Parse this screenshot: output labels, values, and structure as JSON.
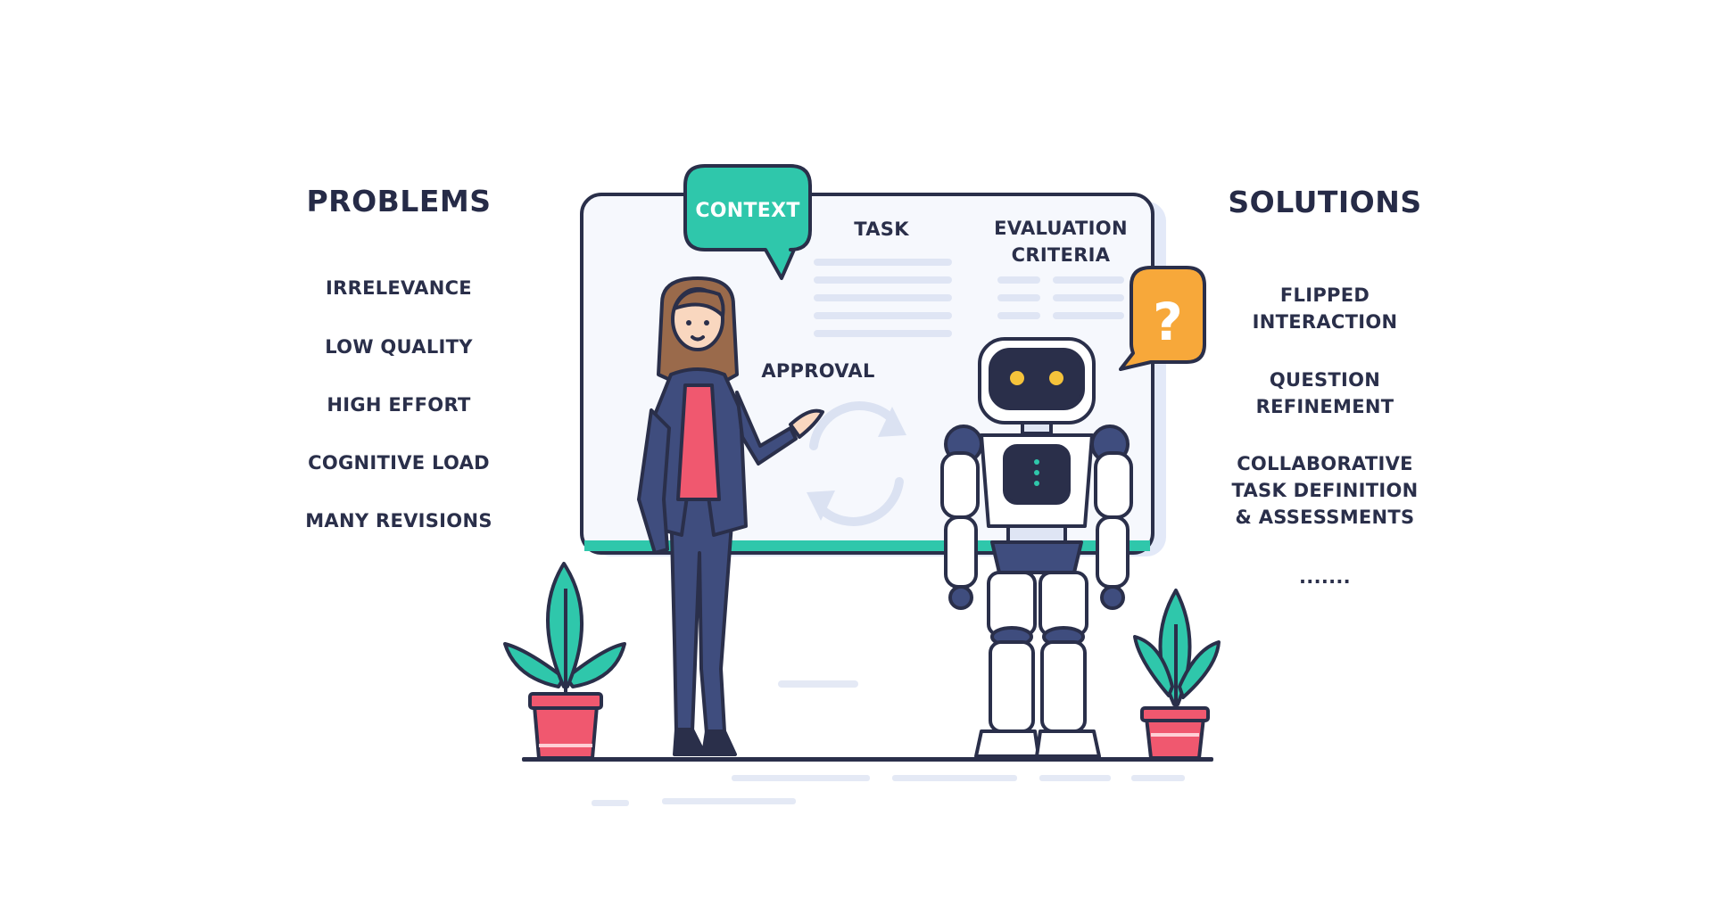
{
  "problems": {
    "heading": "PROBLEMS",
    "items": [
      {
        "label": "IRRELEVANCE"
      },
      {
        "label": "LOW QUALITY"
      },
      {
        "label": "HIGH EFFORT"
      },
      {
        "label": "COGNITIVE LOAD"
      },
      {
        "label": "MANY REVISIONS"
      }
    ]
  },
  "solutions": {
    "heading": "SOLUTIONS",
    "items": [
      {
        "label": "FLIPPED\nINTERACTION"
      },
      {
        "label": "QUESTION\nREFINEMENT"
      },
      {
        "label": "COLLABORATIVE\nTASK DEFINITION\n& ASSESSMENTS"
      },
      {
        "label": "......."
      }
    ]
  },
  "board": {
    "context_label": "CONTEXT",
    "task_label": "TASK",
    "evaluation_line1": "EVALUATION",
    "evaluation_line2": "CRITERIA",
    "approval_label": "APPROVAL",
    "question_mark": "?"
  },
  "colors": {
    "teal": "#2fc7ab",
    "navy": "#2a2f4a",
    "suit": "#3f4d7e",
    "pink": "#f0586f",
    "orange": "#f7a83a",
    "robot_eye": "#f5c33b",
    "hair": "#9a6a4b"
  }
}
